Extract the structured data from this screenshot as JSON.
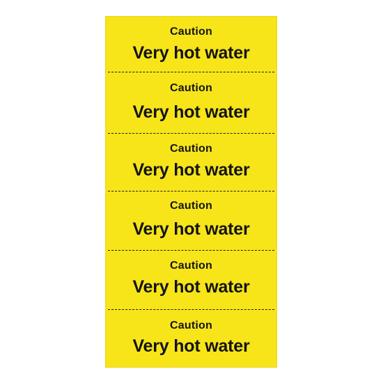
{
  "colors": {
    "sheet_background": "#f7e51a",
    "text": "#141414",
    "cut_line": "#1a1a1a"
  },
  "labels": [
    {
      "caption": "Caution",
      "headline": "Very hot water"
    },
    {
      "caption": "Caution",
      "headline": "Very hot water"
    },
    {
      "caption": "Caution",
      "headline": "Very hot water"
    },
    {
      "caption": "Caution",
      "headline": "Very hot water"
    },
    {
      "caption": "Caution",
      "headline": "Very hot water"
    },
    {
      "caption": "Caution",
      "headline": "Very hot water"
    }
  ]
}
